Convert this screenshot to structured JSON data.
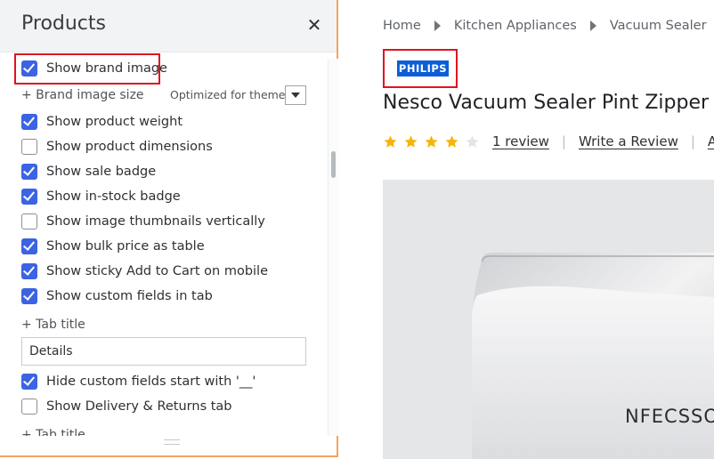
{
  "panel": {
    "title": "Products",
    "close_icon": "close-icon",
    "options": [
      {
        "label": "Show brand image",
        "checked": true
      },
      {
        "label": "Show product weight",
        "checked": true
      },
      {
        "label": "Show product dimensions",
        "checked": false
      },
      {
        "label": "Show sale badge",
        "checked": true
      },
      {
        "label": "Show in-stock badge",
        "checked": true
      },
      {
        "label": "Show image thumbnails vertically",
        "checked": false
      },
      {
        "label": "Show bulk price as table",
        "checked": true
      },
      {
        "label": "Show sticky Add to Cart on mobile",
        "checked": true
      },
      {
        "label": "Show custom fields in tab",
        "checked": true
      },
      {
        "label": "Hide custom fields start with '__'",
        "checked": true
      },
      {
        "label": "Show Delivery & Returns tab",
        "checked": false
      }
    ],
    "brand_image_size": {
      "label": "+ Brand image size",
      "value": "Optimized for theme"
    },
    "tab_title": {
      "label": "+ Tab title",
      "value": "Details"
    },
    "tab_title_2": {
      "label": "+ Tab title"
    },
    "highlight_color": "#e0141e",
    "accent_color": "#3b63e3"
  },
  "store": {
    "breadcrumb": [
      "Home",
      "Kitchen Appliances",
      "Vacuum Sealer"
    ],
    "brand_logo_text": "PHILIPS",
    "product_title": "Nesco Vacuum Sealer Pint Zipper B",
    "rating": {
      "stars": 4,
      "max": 5
    },
    "review_link": "1 review",
    "write_review": "Write a Review",
    "ask_link": "As",
    "image_text": "NFECSSO",
    "star_color": "#f5b50a"
  }
}
